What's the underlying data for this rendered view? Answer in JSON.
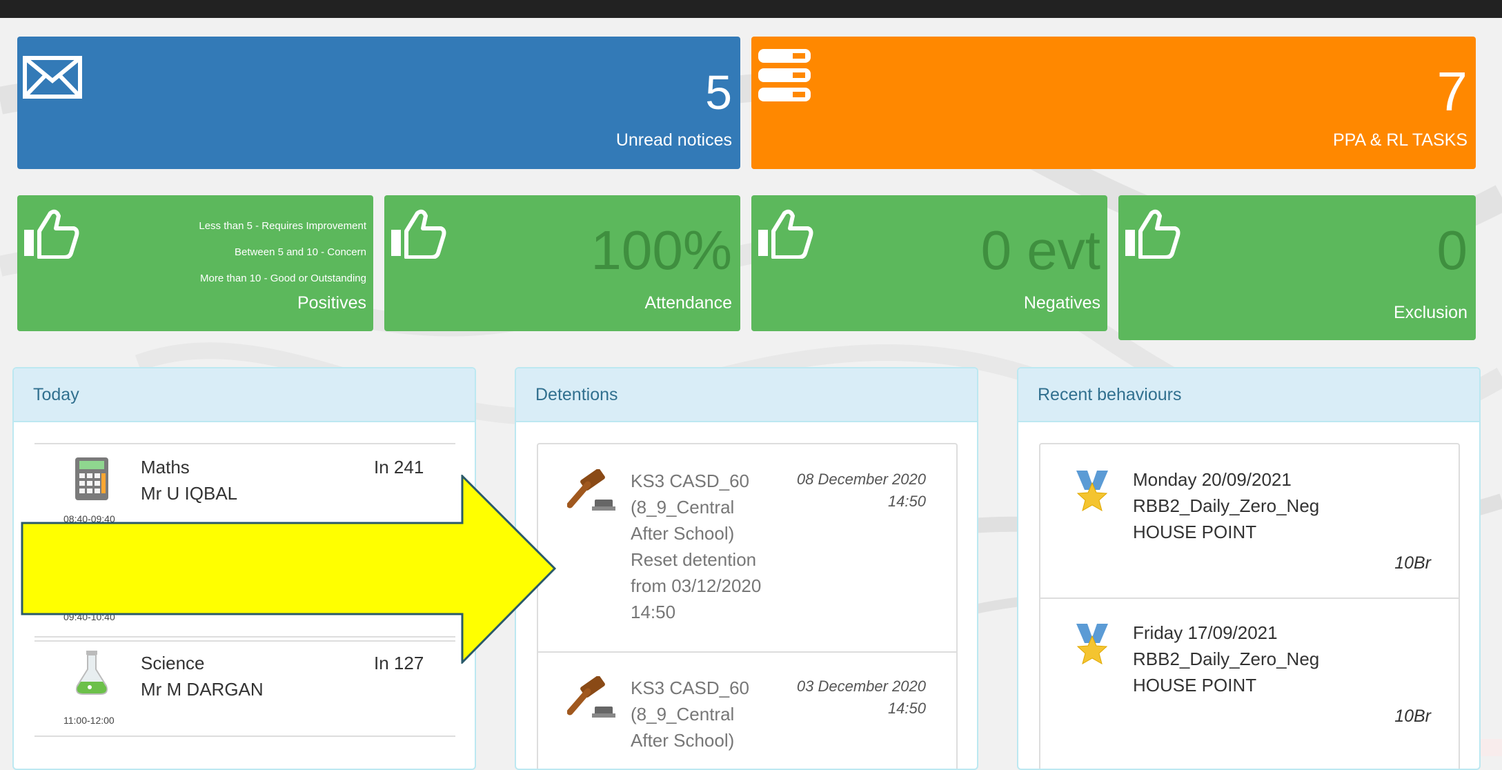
{
  "tiles": {
    "notices": {
      "count": "5",
      "label": "Unread notices",
      "icon": "envelope-icon"
    },
    "tasks": {
      "count": "7",
      "label": "PPA & RL TASKS",
      "icon": "server-stack-icon"
    },
    "positives": {
      "label": "Positives",
      "legend": [
        "Less than 5 - Requires Improvement",
        "Between 5 and 10 - Concern",
        "More than 10 - Good or Outstanding"
      ],
      "icon": "thumbs-up-icon"
    },
    "attendance": {
      "value": "100%",
      "label": "Attendance",
      "icon": "thumbs-up-icon"
    },
    "negatives": {
      "value": "0 evt",
      "label": "Negatives",
      "icon": "thumbs-up-icon"
    },
    "exclusion": {
      "value": "0",
      "label": "Exclusion",
      "icon": "thumbs-up-icon"
    }
  },
  "today": {
    "title": "Today",
    "lessons": [
      {
        "subject": "Maths",
        "teacher": "Mr U IQBAL",
        "room": "In 241",
        "time": "08:40-09:40",
        "icon": "calculator-icon"
      },
      {
        "subject": "",
        "teacher": "",
        "room": "",
        "time": "09:40-10:40",
        "icon": ""
      },
      {
        "subject": "Science",
        "teacher": "Mr M DARGAN",
        "room": "In 127",
        "time": "11:00-12:00",
        "icon": "flask-icon"
      }
    ]
  },
  "detentions": {
    "title": "Detentions",
    "items": [
      {
        "lines": [
          "KS3 CASD_60",
          "(8_9_Central",
          "After School)",
          "Reset detention",
          "from 03/12/2020",
          "14:50"
        ],
        "date": "08 December 2020",
        "time": "14:50",
        "icon": "gavel-icon"
      },
      {
        "lines": [
          "KS3 CASD_60",
          "(8_9_Central",
          "After School)"
        ],
        "date": "03 December 2020",
        "time": "14:50",
        "icon": "gavel-icon"
      }
    ]
  },
  "behaviours": {
    "title": "Recent behaviours",
    "items": [
      {
        "day": "Monday 20/09/2021",
        "type": "RBB2_Daily_Zero_Neg",
        "category": "HOUSE POINT",
        "form": "10Br",
        "icon": "medal-icon"
      },
      {
        "day": "Friday 17/09/2021",
        "type": "RBB2_Daily_Zero_Neg",
        "category": "HOUSE POINT",
        "form": "10Br",
        "icon": "medal-icon"
      }
    ]
  },
  "colors": {
    "blue": "#337ab7",
    "orange": "#ff8800",
    "green": "#5cb85c",
    "panel_header": "#d9edf7",
    "annotation_arrow": "#ffff00"
  }
}
